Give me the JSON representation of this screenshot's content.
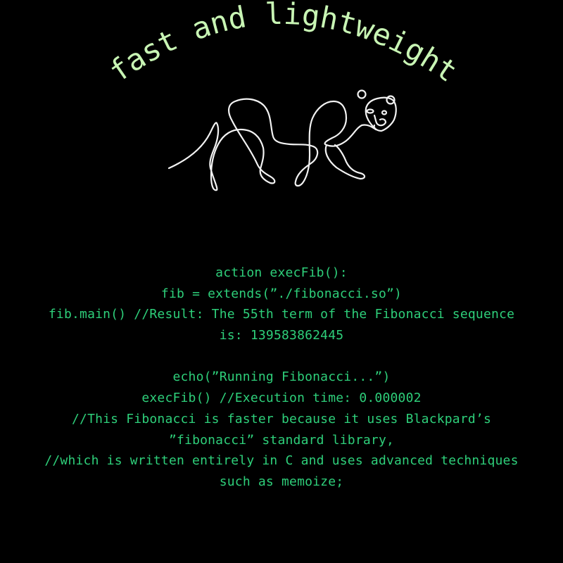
{
  "tagline": {
    "text": "fast and lightweight",
    "color": "#c8f5b4"
  },
  "mascot": {
    "icon": "line-art-big-cat-icon",
    "stroke_color": "#f2f2f2"
  },
  "code": {
    "color": "#2ecf7a",
    "lines": [
      "action execFib():",
      "fib = extends(”./fibonacci.so”)",
      "fib.main() //Result: The 55th term of the Fibonacci sequence",
      "is: 139583862445",
      "",
      "echo(”Running Fibonacci...”)",
      "execFib() //Execution time: 0.000002",
      "//This Fibonacci is faster because it uses Blackpard’s",
      "”fibonacci” standard library,",
      "//which is written entirely in C and uses advanced techniques",
      "such as memoize;"
    ]
  }
}
